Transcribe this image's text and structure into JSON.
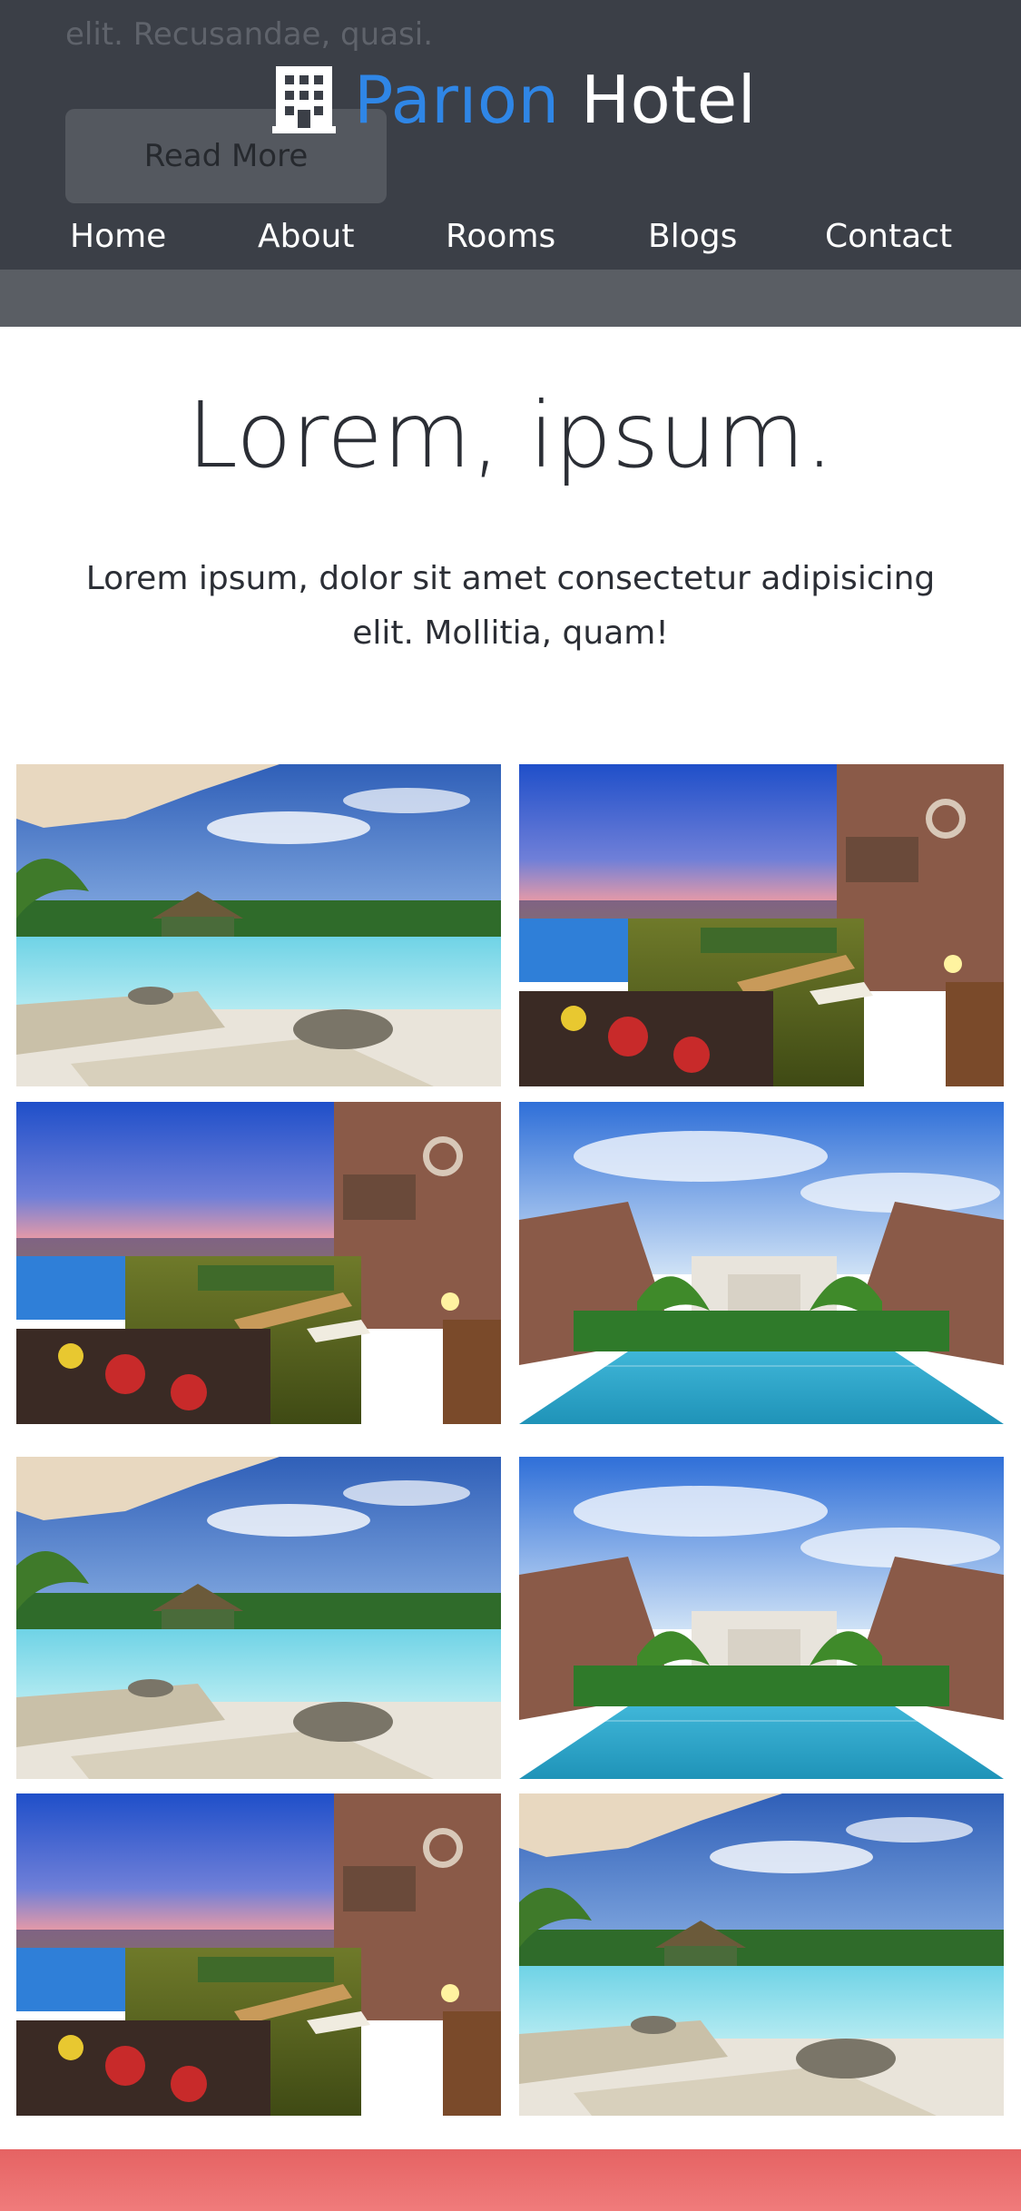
{
  "header": {
    "ghost_text": "elit. Recusandae, quasi.",
    "read_more_label": "Read More",
    "brand": {
      "accent": "Parıon",
      "main": "Hotel",
      "icon": "building-icon"
    },
    "nav": [
      "Home",
      "About",
      "Rooms",
      "Blogs",
      "Contact"
    ]
  },
  "intro": {
    "title": "Lorem, ipsum.",
    "text": "Lorem ipsum, dolor sit amet consectetur adipisicing elit. Mollitia, quam!"
  },
  "gallery": {
    "tiles": [
      "resort-pool-umbrella-photo",
      "sunset-terrace-pool-photo",
      "sunset-terrace-pool-photo",
      "courtyard-pool-photo",
      "resort-pool-umbrella-photo",
      "courtyard-pool-photo",
      "sunset-terrace-pool-photo",
      "resort-pool-umbrella-photo"
    ]
  },
  "colors": {
    "header_bg": "#3b3f47",
    "brand_accent": "#2f86e6",
    "footer_band": "#e56363"
  }
}
